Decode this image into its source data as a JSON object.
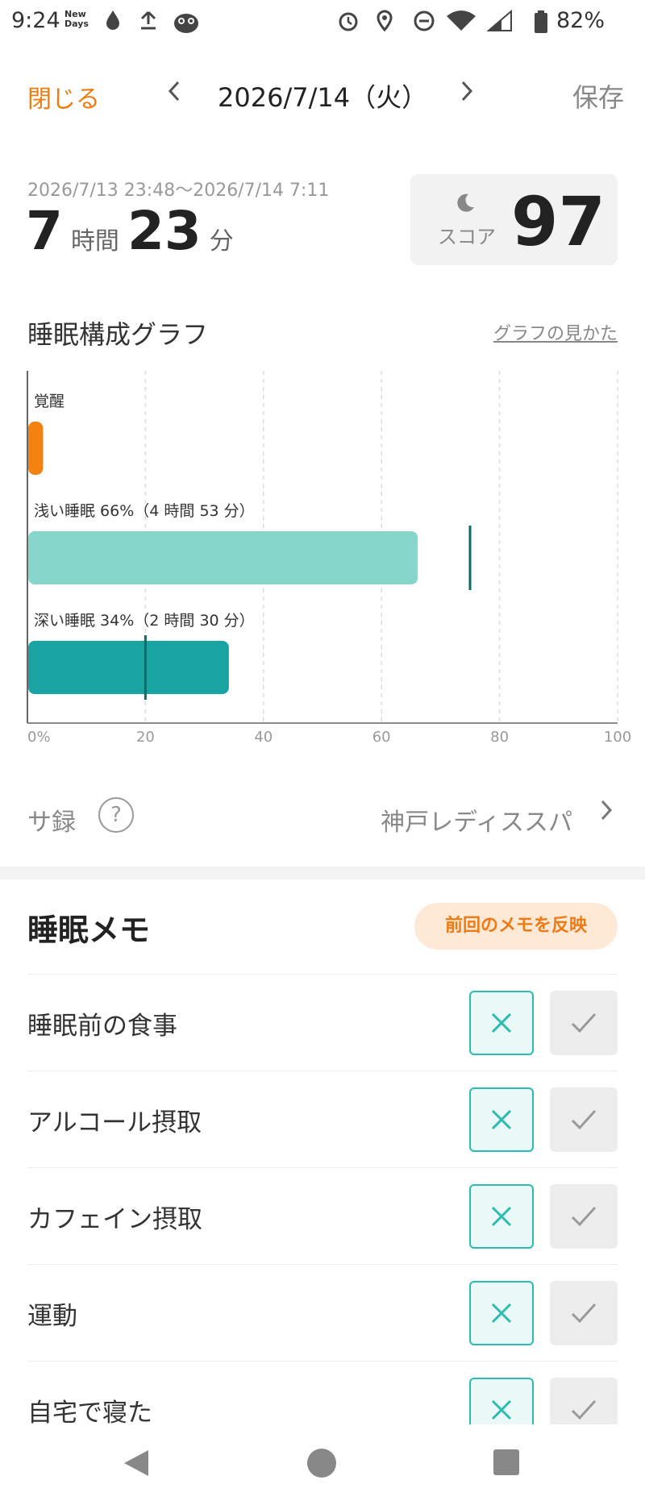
{
  "status_bar": {
    "time": "9:24",
    "newdays_line1": "New",
    "newdays_line2": "Days",
    "battery": "82%",
    "icons": [
      "drop-icon",
      "upload-icon",
      "app-mascot-icon",
      "alarm-icon",
      "location-icon",
      "dnd-icon",
      "wifi-icon",
      "signal-icon",
      "battery-icon"
    ]
  },
  "header": {
    "close": "閉じる",
    "date": "2026/7/14（火）",
    "save": "保存",
    "prev_icon": "chevron-left-icon",
    "next_icon": "chevron-right-icon"
  },
  "summary": {
    "range": "2026/7/13 23:48〜2026/7/14 7:11",
    "hours": "7",
    "hours_unit": "時間",
    "minutes": "23",
    "minutes_unit": "分",
    "score_label": "スコア",
    "score": "97"
  },
  "chart_section": {
    "title": "睡眠構成グラフ",
    "help_link": "グラフの見かた"
  },
  "chart_data": {
    "type": "bar",
    "orientation": "horizontal",
    "categories": [
      "覚醒",
      "浅い睡眠",
      "深い睡眠"
    ],
    "labels": [
      "覚醒",
      "浅い睡眠 66%（4 時間 53 分）",
      "深い睡眠 34%（2 時間 30 分）"
    ],
    "values": [
      2.5,
      66,
      34
    ],
    "reference_markers": [
      null,
      75,
      20
    ],
    "colors": [
      "#f5820f",
      "#86d6cc",
      "#19a3a3"
    ],
    "marker_color": "#0d6b66",
    "xlim": [
      0,
      100
    ],
    "x_ticks": [
      "0%",
      "20",
      "40",
      "60",
      "80",
      "100"
    ],
    "x_tick_values": [
      0,
      20,
      40,
      60,
      80,
      100
    ],
    "grid": true
  },
  "memo_link": {
    "label": "サ録",
    "place": "神戸レディススパ"
  },
  "memo": {
    "title": "睡眠メモ",
    "reflect_button": "前回のメモを反映",
    "items": [
      {
        "label": "睡眠前の食事"
      },
      {
        "label": "アルコール摂取"
      },
      {
        "label": "カフェイン摂取"
      },
      {
        "label": "運動"
      },
      {
        "label": "自宅で寝た"
      }
    ],
    "accent_color": "#2bbbb0"
  }
}
